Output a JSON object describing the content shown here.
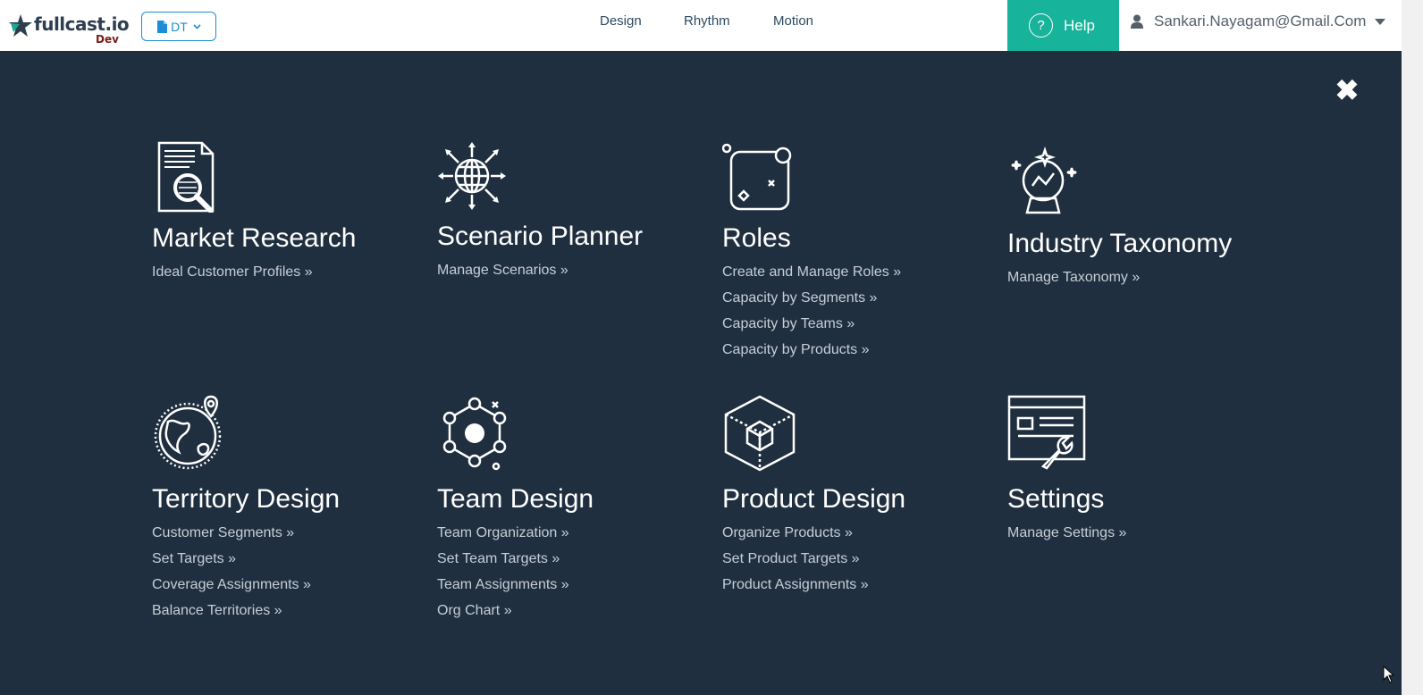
{
  "header": {
    "logo_text": "fullcast.io",
    "logo_env": "Dev",
    "workspace_label": "DT",
    "nav": [
      "Design",
      "Rhythm",
      "Motion"
    ],
    "help_label": "Help",
    "user_email": "Sankari.Nayagam@Gmail.Com"
  },
  "colors": {
    "background": "#202f3f",
    "help_bg": "#17b39a",
    "accent": "#1c8dd6"
  },
  "tiles": [
    {
      "title": "Market Research",
      "icon": "market-research-icon",
      "links": [
        "Ideal Customer Profiles »"
      ]
    },
    {
      "title": "Scenario Planner",
      "icon": "globe-arrows-icon",
      "links": [
        "Manage Scenarios »"
      ]
    },
    {
      "title": "Roles",
      "icon": "roles-icon",
      "links": [
        "Create and Manage Roles »",
        "Capacity by Segments »",
        "Capacity by Teams »",
        "Capacity by Products »"
      ]
    },
    {
      "title": "Industry Taxonomy",
      "icon": "crystal-ball-icon",
      "links": [
        "Manage Taxonomy »"
      ]
    },
    {
      "title": "Territory Design",
      "icon": "globe-pin-icon",
      "links": [
        "Customer Segments »",
        "Set Targets »",
        "Coverage Assignments »",
        "Balance Territories »"
      ]
    },
    {
      "title": "Team Design",
      "icon": "network-icon",
      "links": [
        "Team Organization »",
        "Set Team Targets »",
        "Team Assignments »",
        "Org Chart »"
      ]
    },
    {
      "title": "Product Design",
      "icon": "cube-icon",
      "links": [
        "Organize Products »",
        "Set Product Targets »",
        "Product Assignments »"
      ]
    },
    {
      "title": "Settings",
      "icon": "settings-window-icon",
      "links": [
        "Manage Settings »"
      ]
    }
  ]
}
